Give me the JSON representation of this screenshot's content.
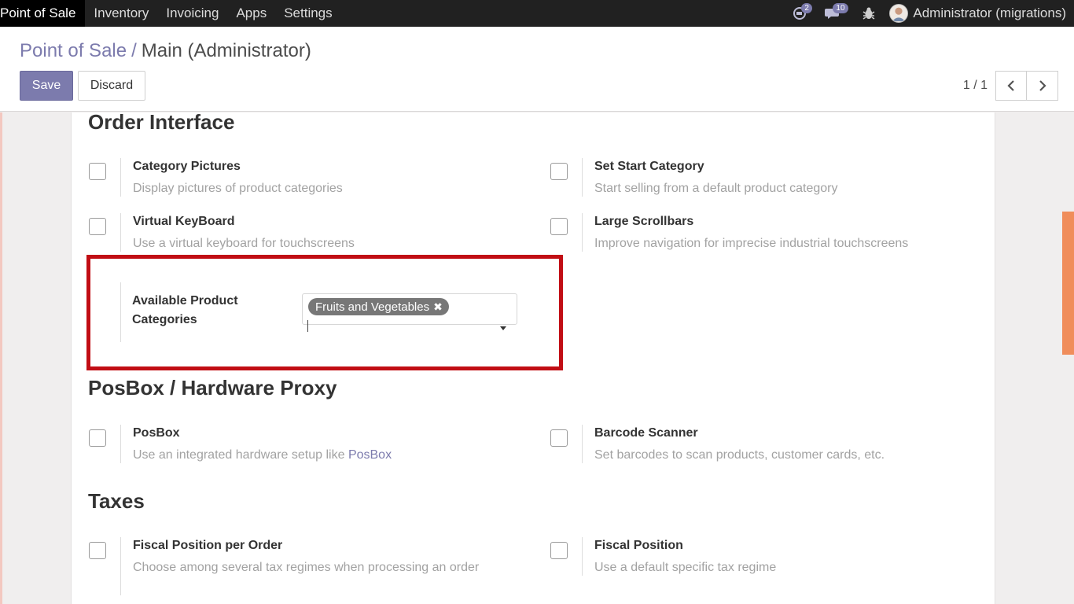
{
  "navbar": {
    "app_name": "Point of Sale",
    "menu": [
      "Inventory",
      "Invoicing",
      "Apps",
      "Settings"
    ],
    "conversation_count": "2",
    "message_count": "10",
    "user_name": "Administrator (migrations)",
    "icons": [
      "conversation-icon",
      "chat-icon",
      "bug-icon"
    ]
  },
  "breadcrumb": {
    "parent": "Point of Sale",
    "separator": "/",
    "current": "Main (Administrator)"
  },
  "buttons": {
    "save": "Save",
    "discard": "Discard"
  },
  "pager": {
    "value": "1 / 1"
  },
  "sections": {
    "order_interface": "Order Interface",
    "posbox": "PosBox / Hardware Proxy",
    "taxes": "Taxes"
  },
  "settings": {
    "category_pictures": {
      "title": "Category Pictures",
      "desc": "Display pictures of product categories",
      "checked": false
    },
    "set_start_category": {
      "title": "Set Start Category",
      "desc": "Start selling from a default product category",
      "checked": false
    },
    "virtual_keyboard": {
      "title": "Virtual KeyBoard",
      "desc": "Use a virtual keyboard for touchscreens",
      "checked": false
    },
    "large_scrollbars": {
      "title": "Large Scrollbars",
      "desc": "Improve navigation for imprecise industrial touchscreens",
      "checked": false
    },
    "posbox": {
      "title": "PosBox",
      "desc": "Use an integrated hardware setup like ",
      "desc_link": "PosBox",
      "checked": false
    },
    "barcode_scanner": {
      "title": "Barcode Scanner",
      "desc": "Set barcodes to scan products, customer cards, etc.",
      "checked": false
    },
    "fiscal_position_per_order": {
      "title": "Fiscal Position per Order",
      "desc": "Choose among several tax regimes when processing an order",
      "checked": false
    },
    "fiscal_position": {
      "title": "Fiscal Position",
      "desc": "Use a default specific tax regime",
      "checked": false
    }
  },
  "available_categories": {
    "label": "Available Product Categories",
    "tags": [
      "Fruits and Vegetables"
    ],
    "remove_symbol": "✖"
  },
  "colors": {
    "navbar_bg": "#212121",
    "brand_primary": "#7c7bad",
    "highlight_border": "#c10d14",
    "scrollbar_accent": "#f08d5b",
    "tag_bg": "#777777"
  }
}
